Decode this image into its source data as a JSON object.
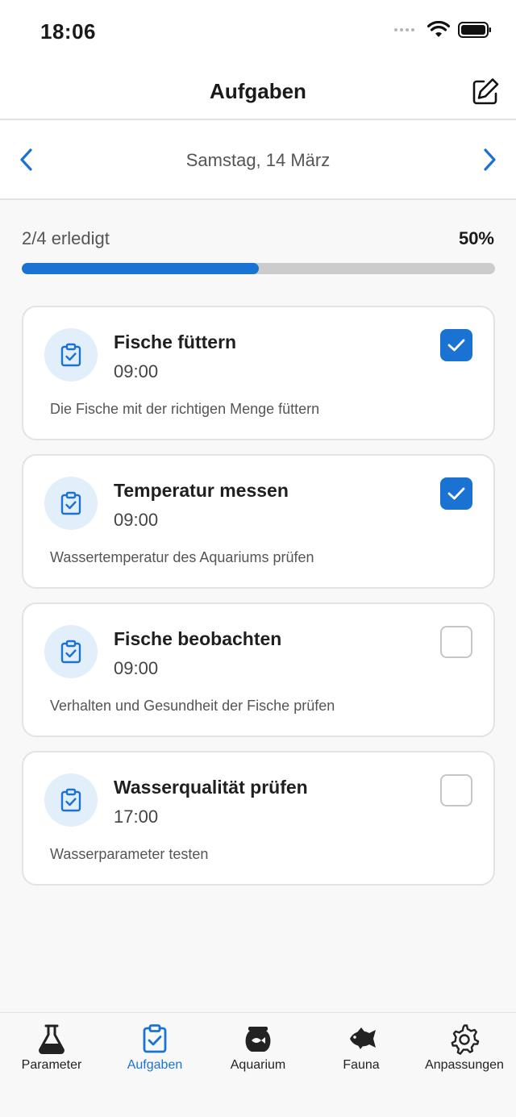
{
  "status_bar": {
    "time": "18:06"
  },
  "header": {
    "title": "Aufgaben",
    "edit_icon": "edit-icon"
  },
  "date_nav": {
    "date": "Samstag, 14 März",
    "prev_icon": "chevron-left-icon",
    "next_icon": "chevron-right-icon"
  },
  "progress": {
    "summary": "2/4 erledigt",
    "percent_label": "50%",
    "value": 0.5
  },
  "colors": {
    "accent": "#1a73d2",
    "icon_bg": "#e3eefb",
    "track": "#cccccc"
  },
  "tasks": [
    {
      "title": "Fische füttern",
      "time": "09:00",
      "description": "Die Fische mit der richtigen Menge füttern",
      "done": true
    },
    {
      "title": "Temperatur messen",
      "time": "09:00",
      "description": "Wassertemperatur des Aquariums prüfen",
      "done": true
    },
    {
      "title": "Fische beobachten",
      "time": "09:00",
      "description": "Verhalten und Gesundheit der Fische prüfen",
      "done": false
    },
    {
      "title": "Wasserqualität prüfen",
      "time": "17:00",
      "description": "Wasserparameter testen",
      "done": false
    }
  ],
  "tabs": [
    {
      "label": "Parameter",
      "icon": "flask-icon",
      "active": false
    },
    {
      "label": "Aufgaben",
      "icon": "clipboard-check-icon",
      "active": true
    },
    {
      "label": "Aquarium",
      "icon": "fishbowl-icon",
      "active": false
    },
    {
      "label": "Fauna",
      "icon": "fish-icon",
      "active": false
    },
    {
      "label": "Anpassungen",
      "icon": "gear-icon",
      "active": false
    }
  ]
}
